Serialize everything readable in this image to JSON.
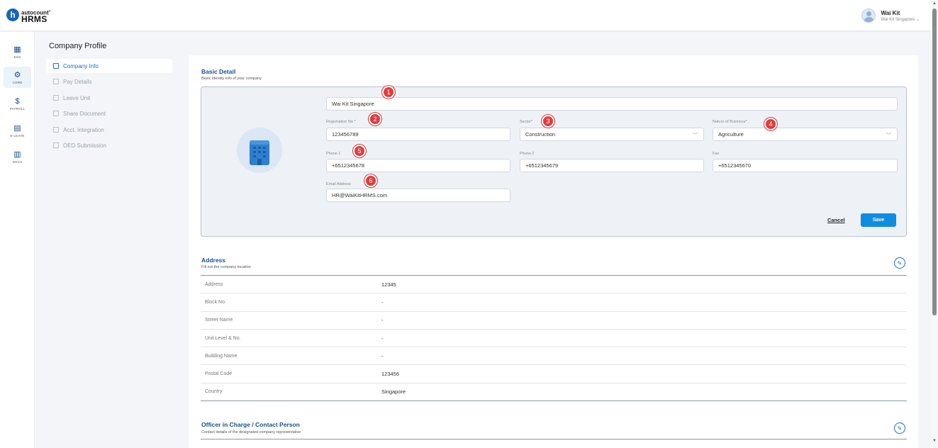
{
  "brand": {
    "top": "autocount",
    "bottom": "HRMS",
    "letter": "h",
    "mark": "®"
  },
  "user": {
    "name": "Wai Kit",
    "company": "Wai Kit Singapore ⌄"
  },
  "leftnav": [
    {
      "label": "ESS",
      "icon": "ess-icon",
      "glyph": "▦"
    },
    {
      "label": "CORE",
      "icon": "core-icon",
      "glyph": "⚙"
    },
    {
      "label": "PAYROLL",
      "icon": "payroll-icon",
      "glyph": "$"
    },
    {
      "label": "E-LEAVE",
      "icon": "calendar-icon",
      "glyph": "▤"
    },
    {
      "label": "DOCS",
      "icon": "document-icon",
      "glyph": "▥"
    }
  ],
  "page_title": "Company Profile",
  "subnav": [
    {
      "label": "Company Info",
      "icon": "company-icon"
    },
    {
      "label": "Pay Details",
      "icon": "pay-icon"
    },
    {
      "label": "Leave Unit",
      "icon": "leave-icon"
    },
    {
      "label": "Share Document",
      "icon": "share-icon"
    },
    {
      "label": "Acct. Integration",
      "icon": "integration-icon"
    },
    {
      "label": "OED Submission",
      "icon": "submission-icon"
    }
  ],
  "basic_detail": {
    "title": "Basic Detail",
    "subtitle": "Basic identity info of your company",
    "company_name": "Wai Kit Singapore",
    "registration_label": "Registration No *",
    "registration_value": "123456789",
    "sector_label": "Sector*",
    "sector_value": "Construction",
    "nature_label": "Nature of Business*",
    "nature_value": "Agriculture",
    "phone1_label": "Phone 1",
    "phone1_value": "+6512345678",
    "phone2_label": "Phone 2",
    "phone2_value": "+6512345679",
    "fax_label": "Fax",
    "fax_value": "+6512345670",
    "email_label": "Email Address",
    "email_value": "HR@WaiKitHRMS.com",
    "cancel_label": "Cancel",
    "save_label": "Save",
    "chevron": "﹀"
  },
  "markers": [
    "1",
    "2",
    "3",
    "4",
    "5",
    "6"
  ],
  "address": {
    "title": "Address",
    "subtitle": "Fill out the company location",
    "rows": [
      {
        "label": "Address",
        "value": "12345"
      },
      {
        "label": "Block No.",
        "value": "-"
      },
      {
        "label": "Street Name",
        "value": "-"
      },
      {
        "label": "Unit Level & No.",
        "value": "-"
      },
      {
        "label": "Building Name",
        "value": "-"
      },
      {
        "label": "Postal Code",
        "value": "123456"
      },
      {
        "label": "Country",
        "value": "Singapore"
      }
    ]
  },
  "officer": {
    "title": "Officer in Charge / Contact Person",
    "subtitle": "Contact details of the designated company representative"
  },
  "colors": {
    "accent": "#1a4f8f",
    "link": "#1a6fd0",
    "save": "#0e8de1",
    "marker": "#e23b3b"
  }
}
